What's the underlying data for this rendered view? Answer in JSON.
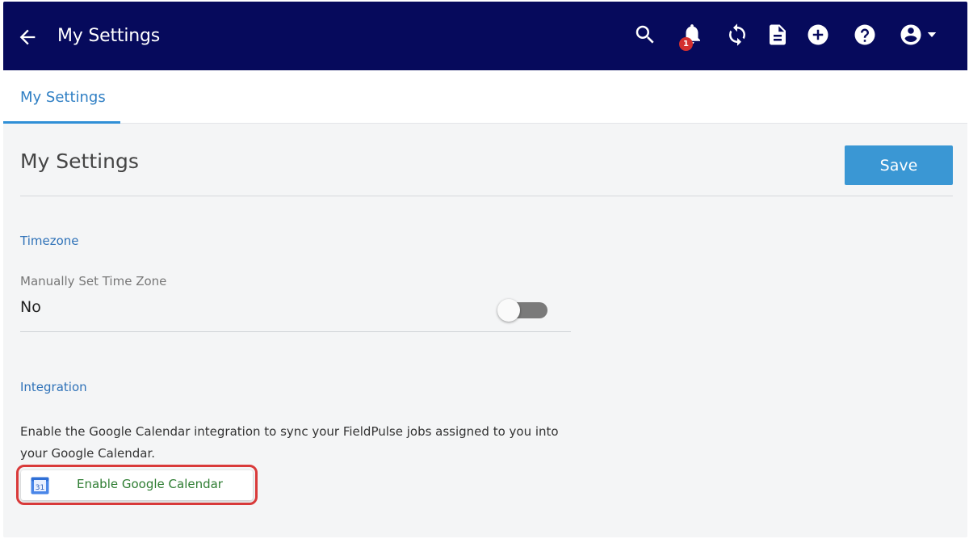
{
  "header": {
    "title": "My Settings",
    "notification_count": "1",
    "icons": [
      "arrow-back-icon",
      "search-icon",
      "bell-icon",
      "sync-icon",
      "document-icon",
      "add-circle-icon",
      "help-icon",
      "account-icon",
      "caret-down-icon"
    ]
  },
  "tabs": [
    {
      "label": "My Settings",
      "active": true
    }
  ],
  "page": {
    "title": "My Settings",
    "save_label": "Save"
  },
  "timezone": {
    "heading": "Timezone",
    "label": "Manually Set Time Zone",
    "value": "No",
    "toggle_on": false
  },
  "integration": {
    "heading": "Integration",
    "description": "Enable the Google Calendar integration to sync your FieldPulse jobs assigned to you into your Google Calendar.",
    "calendar_icon_text": "31",
    "button_label": "Enable Google Calendar"
  },
  "colors": {
    "header_bg": "#060a5c",
    "accent": "#3a97d4",
    "section_heading": "#2f72b8",
    "badge": "#d32f2f",
    "highlight": "#d93a3a",
    "button_text": "#2e7d32"
  }
}
